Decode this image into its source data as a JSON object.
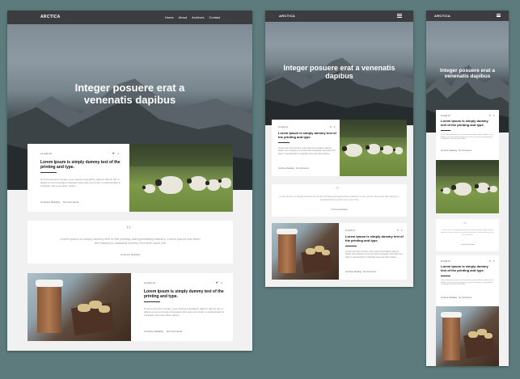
{
  "site": {
    "logo": "ARCTICA",
    "nav": [
      "Home",
      "About",
      "Archives",
      "Contact"
    ]
  },
  "hero": {
    "title": "Integer posuere erat a venenatis dapibus"
  },
  "posts": [
    {
      "date": "11 April 14",
      "likes": "4",
      "title": "Lorem Ipsum is simply dummy text of the printing and type.",
      "excerpt": "Ut enim ad minim veniam, quis nostrud exercitation ullamco laboris nisi ut aliquip ex ea commodo consequat. Duis aute irure dolor in reprehenderit in voluptate velit esse cillum dolore.",
      "read_more": "Continue Reading",
      "comments": "No Comments",
      "image": "sheep-photo"
    },
    {
      "date": "11 April 14",
      "likes": "4",
      "title": "Lorem Ipsum is simply dummy text of the printing and type.",
      "excerpt": "Ut enim ad minim veniam, quis nostrud exercitation ullamco laboris nisi ut aliquip ex ea commodo consequat. Duis aute irure dolor in reprehenderit in voluptate velit esse cillum dolore.",
      "read_more": "Continue Reading",
      "comments": "No Comments",
      "image": "coffee-photo"
    }
  ],
  "quote": {
    "text": "Lorem Ipsum is simply dummy text of the printing and typesetting industry. Lorem Ipsum has been the industry's standard dummy text ever since the",
    "author": "Continue Reading"
  },
  "colors": {
    "background": "#5d7a7c",
    "nav": "#3b3d40",
    "accent": "#e23b3b"
  }
}
